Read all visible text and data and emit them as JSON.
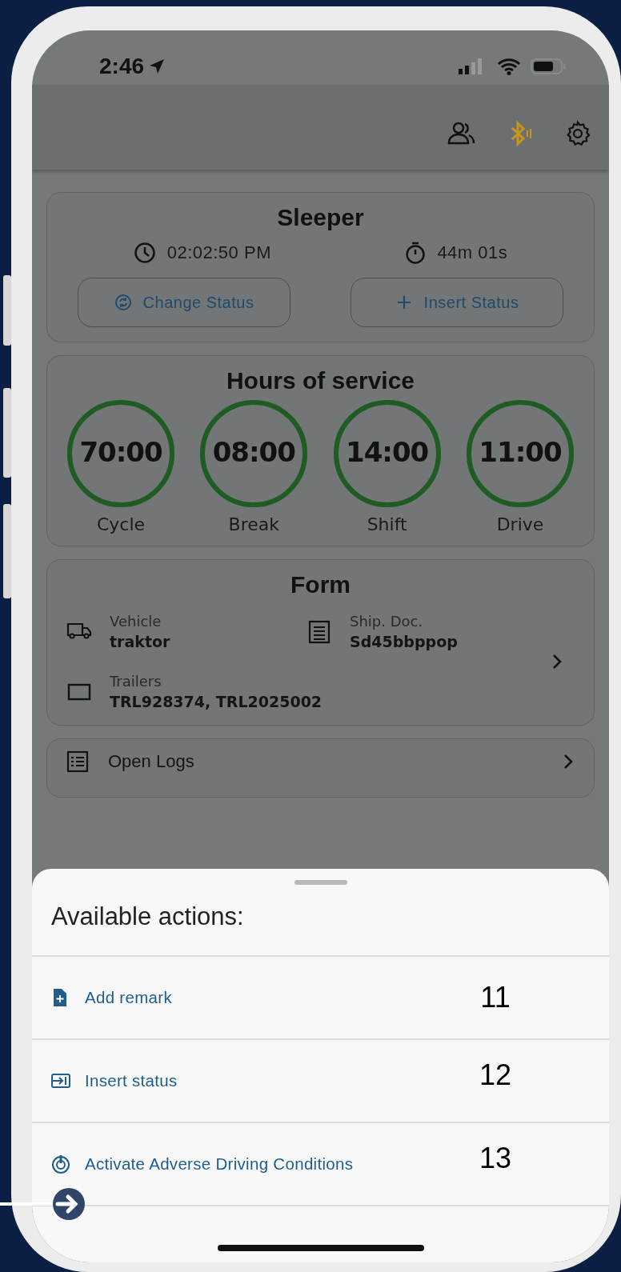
{
  "status_bar": {
    "time": "2:46"
  },
  "sleeper_card": {
    "title": "Sleeper",
    "clock_time": "02:02:50 PM",
    "timer": "44m 01s",
    "buttons": [
      {
        "kind": "change",
        "label": "Change Status"
      },
      {
        "kind": "insert",
        "label": "Insert Status"
      }
    ]
  },
  "hours_of_service": {
    "title": "Hours of service",
    "gauges": [
      {
        "value": "70:00",
        "label": "Cycle",
        "level": 1
      },
      {
        "value": "08:00",
        "label": "Break",
        "level": 1
      },
      {
        "value": "14:00",
        "label": "Shift",
        "level": 1
      },
      {
        "value": "11:00",
        "label": "Drive",
        "level": 1
      }
    ]
  },
  "form_card": {
    "title": "Form",
    "fields": [
      {
        "kind": "vehicle",
        "label": "Vehicle",
        "value": "traktor"
      },
      {
        "kind": "document",
        "label": "Ship. Doc.",
        "value": "Sd45bbppop"
      },
      {
        "kind": "trailer",
        "label": "Trailers",
        "value": "TRL928374, TRL2025002"
      }
    ]
  },
  "open_logs": {
    "label": "Open Logs"
  },
  "action_sheet": {
    "title": "Available actions:",
    "actions": [
      {
        "kind": "remark",
        "label": "Add remark",
        "marker": "11"
      },
      {
        "kind": "insert",
        "label": "Insert status",
        "marker": "12"
      },
      {
        "kind": "adverse",
        "label": "Activate Adverse Driving Conditions",
        "marker": "13"
      }
    ]
  }
}
